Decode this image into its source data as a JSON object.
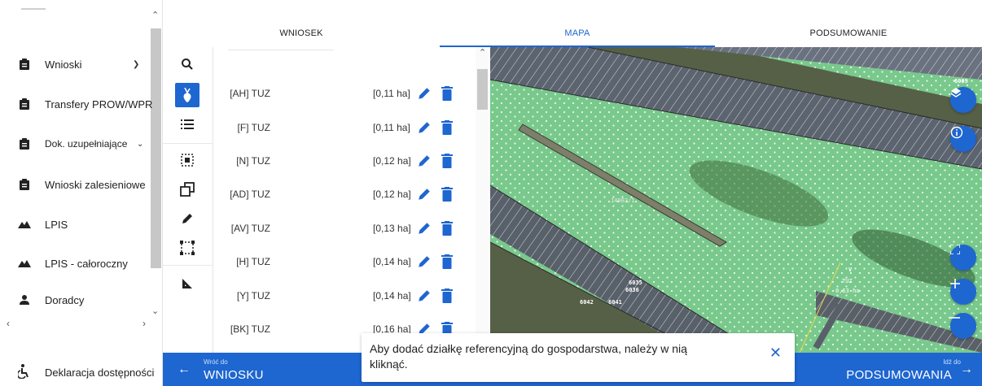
{
  "sidebar": {
    "items": [
      {
        "label": "Wnioski",
        "icon": "clipboard-icon",
        "has_chevron": true
      },
      {
        "label": "Transfery PROW/WPR",
        "icon": "clipboard-icon",
        "has_chevron": true
      },
      {
        "label": "Dok. uzupełniające",
        "icon": "clipboard-icon",
        "has_chevron": true
      },
      {
        "label": "Wnioski zalesieniowe",
        "icon": "clipboard-icon",
        "has_chevron": true
      },
      {
        "label": "LPIS",
        "icon": "terrain-icon",
        "has_chevron": false
      },
      {
        "label": "LPIS - całoroczny",
        "icon": "terrain-icon",
        "has_chevron": false
      },
      {
        "label": "Doradcy",
        "icon": "person-icon",
        "has_chevron": false
      }
    ],
    "footer": {
      "label": "Deklaracja dostępności",
      "icon": "accessibility-icon"
    }
  },
  "tabs": [
    {
      "label": "WNIOSEK",
      "active": false
    },
    {
      "label": "MAPA",
      "active": true
    },
    {
      "label": "PODSUMOWANIE",
      "active": false
    }
  ],
  "tools": [
    {
      "icon": "search-icon",
      "active": false
    },
    {
      "icon": "crop-beet-icon",
      "active": true
    },
    {
      "icon": "list-icon",
      "active": false
    },
    {
      "icon": "select-parcel-icon",
      "active": false
    },
    {
      "icon": "copy-shape-icon",
      "active": false
    },
    {
      "icon": "pencil-icon",
      "active": false
    },
    {
      "icon": "rectangle-select-icon",
      "active": false
    },
    {
      "icon": "measure-angle-icon",
      "active": false
    }
  ],
  "parcels": [
    {
      "name": "[AH] TUZ",
      "area": "[0,11 ha]"
    },
    {
      "name": "[F] TUZ",
      "area": "[0,11 ha]"
    },
    {
      "name": "[N] TUZ",
      "area": "[0,12 ha]"
    },
    {
      "name": "[AD] TUZ",
      "area": "[0,12 ha]"
    },
    {
      "name": "[AV] TUZ",
      "area": "[0,13 ha]"
    },
    {
      "name": "[H] TUZ",
      "area": "[0,14 ha]"
    },
    {
      "name": "[Y] TUZ",
      "area": "[0,14 ha]"
    },
    {
      "name": "[BK] TUZ",
      "area": "[0,16 ha]"
    }
  ],
  "map": {
    "labels": {
      "l6009": "6009",
      "l14902": "14902/1",
      "l6035": "6035",
      "l6036": "6036",
      "l6042": "6042",
      "l6041": "6041",
      "lv": "V",
      "ltuz": "TUZ",
      "lha": "0,63 ha"
    },
    "buttons": [
      "layers-icon",
      "info-icon",
      "fullscreen-icon",
      "zoom-in-icon",
      "zoom-out-icon"
    ],
    "colors": {
      "accent": "#1e66d0",
      "parcel_fill": "#8fe3b0"
    }
  },
  "bottom_bar": {
    "back_small": "Wróć do",
    "back_big": "WNIOSKU",
    "next_small": "Idź do",
    "next_big": "PODSUMOWANIA"
  },
  "toast": {
    "message": "Aby dodać działkę referencyjną do gospodarstwa, należy w nią kliknąć."
  }
}
